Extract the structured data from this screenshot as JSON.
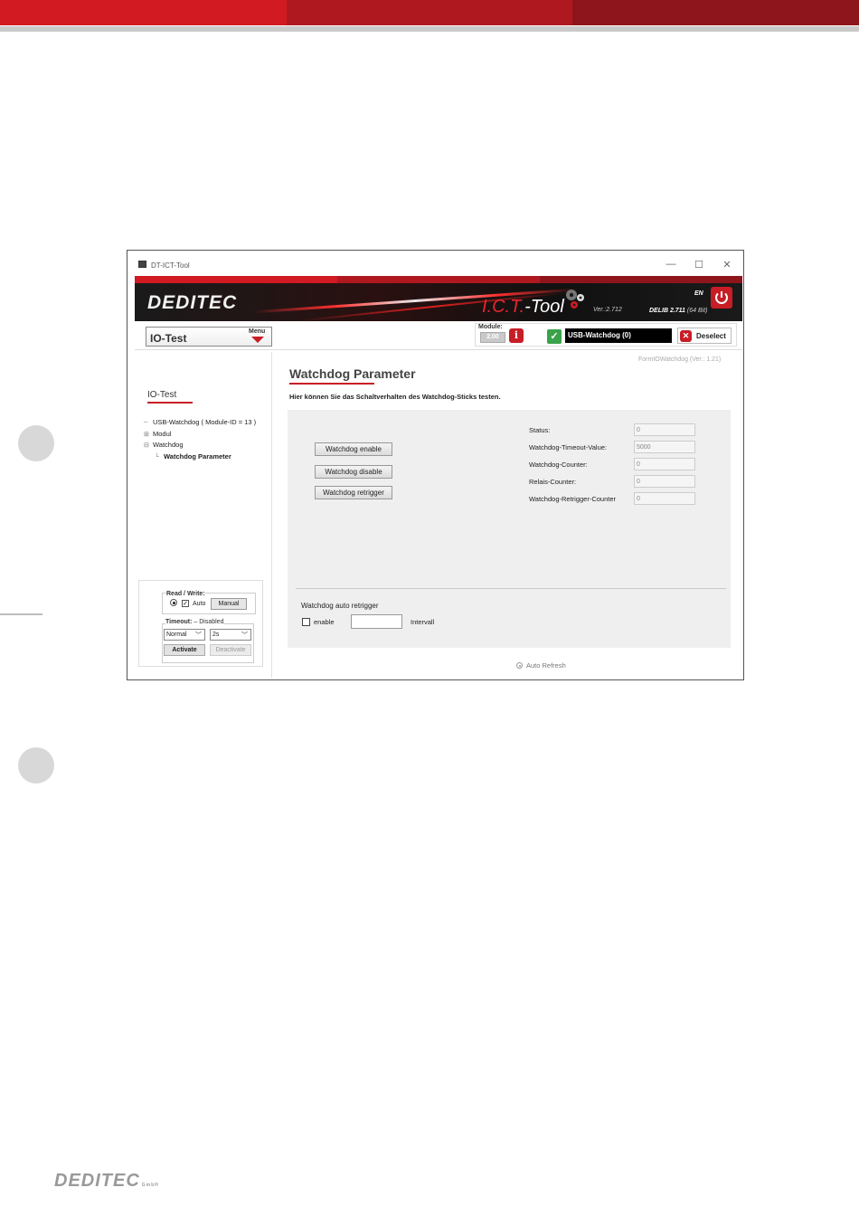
{
  "window": {
    "title": "DT-ICT-Tool",
    "min_glyph": "—",
    "max_glyph": "☐",
    "close_glyph": "✕"
  },
  "banner": {
    "brand": "DEDITEC",
    "product_prefix": "I.C.T.",
    "product_suffix": "-Tool",
    "version": "Ver.:2.712",
    "language": "EN",
    "delib": "DELIB 2.711",
    "delib_bits": "(64 Bit)"
  },
  "toolbar": {
    "menu_value": "IO-Test",
    "menu_label": "Menu",
    "module_label": "Module:",
    "module_value": "2.00",
    "info_glyph": "i",
    "check_glyph": "✓",
    "device_name": "USB-Watchdog (0)",
    "deselect_label": "Deselect",
    "deselect_glyph": "✕"
  },
  "sidebar": {
    "title": "IO-Test",
    "tree": [
      {
        "sym": "",
        "label": "USB-Watchdog ( Module-ID = 13 )",
        "bold": false
      },
      {
        "sym": "⊞",
        "label": "Modul",
        "bold": false
      },
      {
        "sym": "⊟",
        "label": "Watchdog",
        "bold": false
      },
      {
        "sym": "└",
        "label": "Watchdog Parameter",
        "bold": true
      }
    ],
    "read_write_label": "Read / Write:",
    "auto_label": "Auto",
    "manual_label": "Manual",
    "timeout_label": "Timeout:",
    "timeout_state": "Disabled",
    "timeout_mode": "Normal",
    "timeout_time": "2s",
    "activate_label": "Activate",
    "deactivate_label": "Deactivate",
    "checkbox_glyph": "✓"
  },
  "main": {
    "form_version": "FormIOWatchdog (Ver.: 1.21)",
    "title": "Watchdog Parameter",
    "subtitle": "Hier können Sie das Schaltverhalten des Watchdog-Sticks testen.",
    "buttons": {
      "enable": "Watchdog enable",
      "disable": "Watchdog disable",
      "retrigger": "Watchdog retrigger"
    },
    "fields": [
      {
        "label": "Status:",
        "value": "0"
      },
      {
        "label": "Watchdog-Timeout-Value:",
        "value": "5000"
      },
      {
        "label": "Watchdog-Counter:",
        "value": "0"
      },
      {
        "label": "Relais-Counter:",
        "value": "0"
      },
      {
        "label": "Watchdog-Retrigger-Counter",
        "value": "0"
      }
    ],
    "auto_retrigger_title": "Watchdog auto retrigger",
    "enable_label": "enable",
    "interval_value": "",
    "interval_label": "Intervall",
    "auto_refresh_label": "Auto Refresh"
  },
  "footer": {
    "brand": "DEDITEC",
    "gmbh": "GmbH"
  },
  "colors": {
    "accent_red": "#c81d25",
    "ok_green": "#3aa34a"
  }
}
